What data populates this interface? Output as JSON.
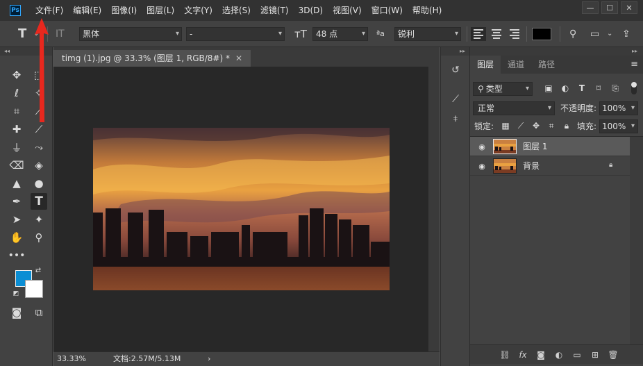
{
  "menu": [
    "文件(F)",
    "编辑(E)",
    "图像(I)",
    "图层(L)",
    "文字(Y)",
    "选择(S)",
    "滤镜(T)",
    "3D(D)",
    "视图(V)",
    "窗口(W)",
    "帮助(H)"
  ],
  "app_logo": "Ps",
  "window_buttons": {
    "minimize": "—",
    "restore": "☐",
    "close": "✕"
  },
  "options": {
    "font_family": "黑体",
    "font_style": "-",
    "font_size": "48 点",
    "antialias": "锐利"
  },
  "document": {
    "tab_title": "timg (1).jpg @ 33.3% (图层 1, RGB/8#) *",
    "tab_close": "✕",
    "zoom": "33.33%",
    "doc_info": "文档:2.57M/5.13M",
    "status_arrow": "›"
  },
  "layers_panel": {
    "tabs": [
      "图层",
      "通道",
      "路径"
    ],
    "filter_type": "类型",
    "blend_mode": "正常",
    "opacity_label": "不透明度:",
    "opacity_value": "100%",
    "lock_label": "锁定:",
    "fill_label": "填充:",
    "fill_value": "100%",
    "layers": [
      {
        "name": "图层 1",
        "selected": true,
        "locked": false
      },
      {
        "name": "背景",
        "selected": false,
        "locked": true
      }
    ]
  },
  "colors": {
    "foreground": "#0b8ed4",
    "background": "#ffffff",
    "annotation_arrow": "#e8281e"
  }
}
